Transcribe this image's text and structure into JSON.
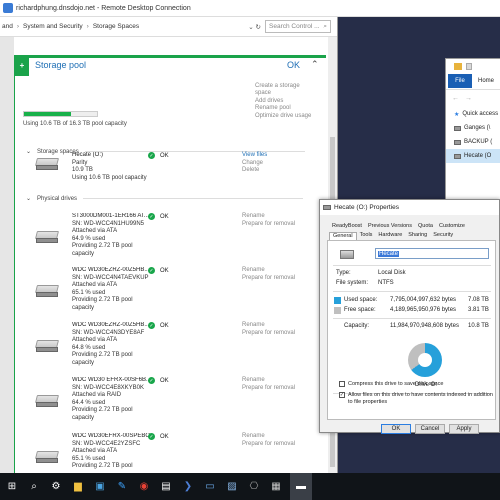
{
  "rdp_title": "richardphung.dnsdojo.net - Remote Desktop Connection",
  "address_bar": {
    "crumbs": [
      "and",
      "System and Security",
      "Storage Spaces"
    ],
    "search_placeholder": "Search Control ..."
  },
  "pool": {
    "title": "Storage pool",
    "ok_label": "OK",
    "progress_percent": 65,
    "usage_text": "Using 10.6 TB of 16.3 TB pool capacity",
    "tasks": [
      "Create a storage",
      "space",
      "Add drives",
      "Rename pool",
      "Optimize drive usage"
    ]
  },
  "storage_spaces": {
    "header": "Storage spaces",
    "items": [
      {
        "name": "Hecate (O:)",
        "lines": [
          "Parity",
          "10.9 TB",
          "Using 10.6 TB pool capacity"
        ],
        "status": "OK",
        "actions": [
          "View files",
          "Change",
          "Delete"
        ]
      }
    ]
  },
  "physical_drives": {
    "header": "Physical drives",
    "items": [
      {
        "name": "ST3000DM001-1ER166 AT...",
        "lines": [
          "SN: WD-WCC4N1HU99N5",
          "Attached via ATA",
          "64.9 % used",
          "Providing 2.72 TB pool",
          "capacity"
        ],
        "status": "OK",
        "actions": [
          "Rename",
          "Prepare for removal"
        ]
      },
      {
        "name": "WDC WD30EZRZ-00Z5HB...",
        "lines": [
          "SN: WD-WCC4N4TAEVKUP",
          "Attached via ATA",
          "65.1 % used",
          "Providing 2.72 TB pool",
          "capacity"
        ],
        "status": "OK",
        "actions": [
          "Rename",
          "Prepare for removal"
        ]
      },
      {
        "name": "WDC WD30EZRZ-00Z5HB...",
        "lines": [
          "SN: WD-WCC4N3DYE8AF",
          "Attached via ATA",
          "64.8 % used",
          "Providing 2.72 TB pool",
          "capacity"
        ],
        "status": "OK",
        "actions": [
          "Rename",
          "Prepare for removal"
        ]
      },
      {
        "name": "WDC WD30 EFRX-00SF6B...",
        "lines": [
          "SN: WD-WCC4E8XKYB0K",
          "Attached via RAID",
          "64.4 % used",
          "Providing 2.72 TB pool",
          "capacity"
        ],
        "status": "OK",
        "actions": [
          "Rename",
          "Prepare for removal"
        ]
      },
      {
        "name": "WDC WD30EFRX-00SPEBO...",
        "lines": [
          "SN: WD-WCC4E2YZSFC",
          "Attached via ATA",
          "65.1 % used",
          "Providing 2.72 TB pool"
        ],
        "status": "OK",
        "actions": [
          "Rename",
          "Prepare for removal"
        ]
      }
    ]
  },
  "explorer": {
    "file_tab": "File",
    "home_tab": "Home",
    "items": [
      "Quick access",
      "Ganges (\\",
      "BACKUP (",
      "Hecate (O"
    ]
  },
  "properties": {
    "title": "Hecate (O:) Properties",
    "tabs_row1": [
      "ReadyBoost",
      "Previous Versions",
      "Quota",
      "Customize"
    ],
    "tabs_row2": [
      "General",
      "Tools",
      "Hardware",
      "Sharing",
      "Security"
    ],
    "drive_name": "Hecate",
    "type_label": "Type:",
    "type_value": "Local Disk",
    "fs_label": "File system:",
    "fs_value": "NTFS",
    "used_label": "Used space:",
    "used_bytes": "7,795,004,997,632 bytes",
    "used_tb": "7.08 TB",
    "free_label": "Free space:",
    "free_bytes": "4,189,965,950,976 bytes",
    "free_tb": "3.81 TB",
    "capacity_label": "Capacity:",
    "capacity_bytes": "11,984,970,948,608 bytes",
    "capacity_tb": "10.8 TB",
    "used_fraction": 0.65,
    "drive_label": "Drive O:",
    "compress_label": "Compress this drive to save disk space",
    "index_label": "Allow files on this drive to have contents indexed in addition to file properties",
    "ok_label": "OK",
    "cancel_label": "Cancel",
    "apply_label": "Apply",
    "used_color": "#26a0da",
    "free_color": "#bfbfbf"
  },
  "taskbar_icons": [
    "windows-icon",
    "search-icon",
    "settings-icon",
    "folder-icon",
    "store-icon",
    "chrome-icon",
    "terminal-icon",
    "powershell-icon",
    "remote-desktop-icon",
    "photos-icon",
    "network-icon",
    "drive-icon"
  ]
}
